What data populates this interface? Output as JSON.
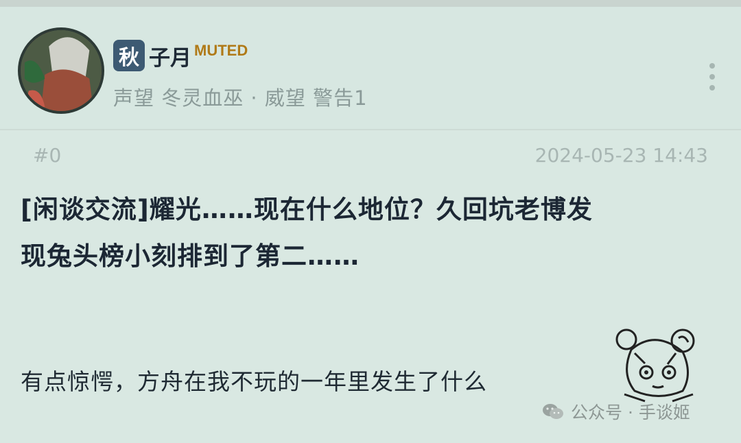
{
  "user": {
    "badge_char": "秋",
    "name": "子月",
    "status_tag": "MUTED",
    "meta_line": "声望 冬灵血巫 · 威望 警告1"
  },
  "post": {
    "floor": "#0",
    "timestamp": "2024-05-23 14:43",
    "title_line1": "[闲谈交流]耀光……现在什么地位？久回坑老博发",
    "title_line2": "现兔头榜小刻排到了第二……",
    "body": "有点惊愕，方舟在我不玩的一年里发生了什么"
  },
  "watermark": {
    "text": "公众号 · 手谈姬"
  },
  "icons": {
    "more": "more-vertical-icon",
    "avatar": "avatar-image",
    "sticker": "chibi-sticker",
    "wechat": "wechat-icon"
  }
}
